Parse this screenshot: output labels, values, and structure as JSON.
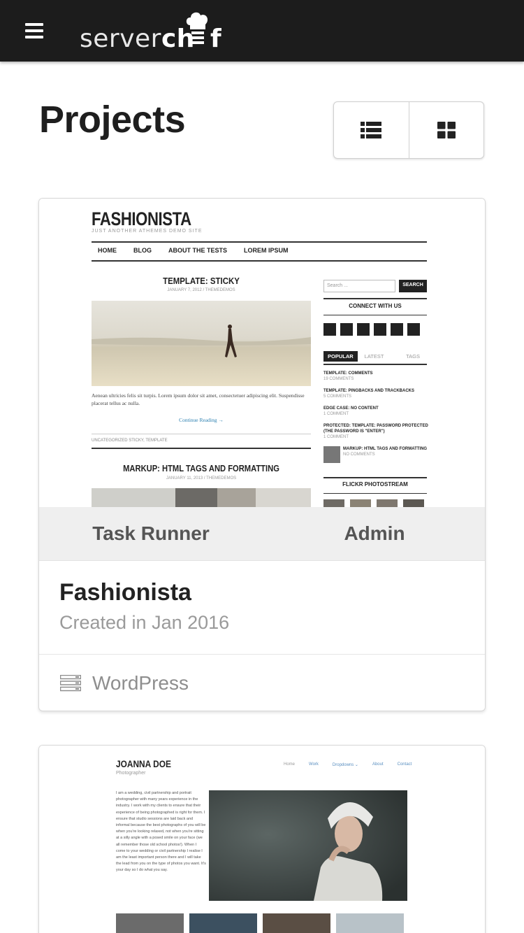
{
  "header": {
    "menu_icon": "hamburger-icon",
    "logo_part1": "server",
    "logo_part2": "ch",
    "logo_part3": "f"
  },
  "page": {
    "title": "Projects",
    "view_toggle": [
      {
        "icon": "list-view-icon"
      },
      {
        "icon": "grid-view-icon"
      }
    ]
  },
  "projects": [
    {
      "actions": [
        "Task Runner",
        "Admin"
      ],
      "name": "Fashionista",
      "created": "Created in Jan 2016",
      "stack_icon": "server-stack-icon",
      "stack": "WordPress",
      "preview": {
        "brand": "FASHIONISTA",
        "tagline": "JUST ANOTHER ATHEMES DEMO SITE",
        "nav": [
          "HOME",
          "BLOG",
          "ABOUT THE TESTS",
          "LOREM IPSUM"
        ],
        "post1_title": "TEMPLATE: STICKY",
        "post1_date": "JANUARY 7, 2012 / THEMEDEMOS",
        "post1_excerpt": "Aenean ultricies felis sit turpis. Lorem ipsum dolor sit amet, consectetuer adipiscing elit. Suspendisse placerat tellus ac nulla.",
        "post1_more": "Continue Reading →",
        "post1_tags": "UNCATEGORIZED    STICKY, TEMPLATE",
        "post2_title": "MARKUP: HTML TAGS AND FORMATTING",
        "post2_date": "JANUARY 11, 2013 / THEMEDEMOS",
        "search_placeholder": "Search ...",
        "search_button": "SEARCH",
        "connect": "CONNECT WITH US",
        "tabs": [
          "POPULAR",
          "LATEST",
          "TAGS"
        ],
        "popular": [
          {
            "title": "TEMPLATE: COMMENTS",
            "sub": "19 COMMENTS"
          },
          {
            "title": "TEMPLATE: PINGBACKS AND TRACKBACKS",
            "sub": "5 COMMENTS"
          },
          {
            "title": "EDGE CASE: NO CONTENT",
            "sub": "1 COMMENT"
          },
          {
            "title": "PROTECTED: TEMPLATE: PASSWORD PROTECTED (THE PASSWORD IS \"ENTER\")",
            "sub": "1 COMMENT"
          },
          {
            "title": "MARKUP: HTML TAGS AND FORMATTING",
            "sub": "NO COMMENTS"
          }
        ],
        "flickr": "FLICKR PHOTOSTREAM"
      }
    },
    {
      "preview": {
        "brand": "JOANNA DOE",
        "tagline": "Photographer",
        "nav": [
          "Home",
          "Work",
          "Dropdowns ⌄",
          "About",
          "Contact"
        ],
        "intro": "I am a wedding, civil partnership and portrait photographer with many years experience in the industry. I work with my clients to ensure that their experience of being photographed is right for them. I ensure that studio sessions are laid back and informal because the best photographs of you will be when you're looking relaxed, not when you're sitting at a silly angle with a posed smile on your face (we all remember those old school photos!). When I come to your wedding or civil partnership I realise I am the least important person there and I will take the lead from you on the type of photos you want. It's your day so I do what you say."
      }
    }
  ]
}
